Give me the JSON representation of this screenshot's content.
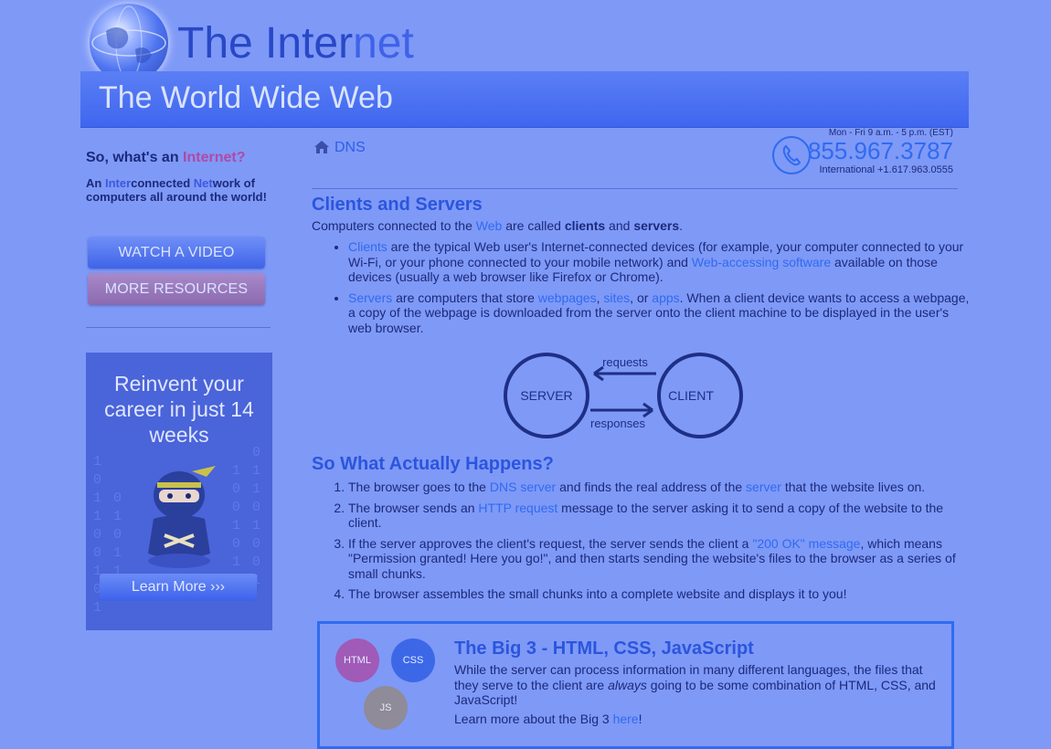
{
  "header": {
    "title_main": "The Inter",
    "title_net": "net",
    "banner": "The World Wide Web"
  },
  "sidebar": {
    "question_prefix": "So, what's an ",
    "question_highlight": "Internet?",
    "desc_parts": [
      "An ",
      "Inter",
      "connected ",
      "Net",
      "work of computers all around the world!"
    ],
    "watch_video": "WATCH A VIDEO",
    "more_resources": "MORE RESOURCES",
    "ad": {
      "title": "Reinvent your career in just 14 weeks",
      "button": "Learn More ›››"
    }
  },
  "breadcrumb": {
    "label": "DNS"
  },
  "contact": {
    "hours": "Mon - Fri 9 a.m. - 5 p.m. (EST)",
    "phone": "855.967.3787",
    "international": "International +1.617.963.0555"
  },
  "clients_servers": {
    "heading": "Clients and Servers",
    "intro": {
      "a": "Computers connected to the ",
      "link": "Web",
      "b": " are called ",
      "c": "clients",
      "d": " and ",
      "e": "servers",
      "f": "."
    },
    "bullet1": {
      "link1": "Clients",
      "a": " are the typical Web user's Internet-connected devices (for example, your computer connected to your Wi-Fi, or your phone connected to your mobile network) and ",
      "link2": "Web-accessing software",
      "b": " available on those devices (usually a web browser like Firefox or Chrome)."
    },
    "bullet2": {
      "link1": "Servers",
      "a": " are computers that store ",
      "link2": "webpages",
      "b": ", ",
      "link3": "sites",
      "c": ", or ",
      "link4": "apps",
      "d": ". When a client device wants to access a webpage, a copy of the webpage is downloaded from the server onto the client machine to be displayed in the user's web browser."
    },
    "diagram": {
      "server": "SERVER",
      "client": "CLIENT",
      "requests": "requests",
      "responses": "responses"
    }
  },
  "what_happens": {
    "heading": "So What Actually Happens?",
    "step1": {
      "a": "The browser goes to the ",
      "link1": "DNS server",
      "b": " and finds the real address of the ",
      "link2": "server",
      "c": " that the website lives on."
    },
    "step2": {
      "a": "The browser sends an ",
      "link": "HTTP request",
      "b": " message to the server asking it to send a copy of the website to the client."
    },
    "step3": {
      "a": "If the server approves the client's request, the server sends the client a ",
      "link": "\"200 OK\" message",
      "b": ", which means \"Permission granted! Here you go!\", and then starts sending the website's files to the browser as a series of small chunks."
    },
    "step4": {
      "a": "The browser assembles the small chunks into a complete website and displays it to you!"
    }
  },
  "big3": {
    "heading": "The Big 3 - HTML, CSS, JavaScript",
    "p1a": "While the server can process information in many different languages, the files that they serve to the client are ",
    "p1em": "always",
    "p1b": " going to be some combination of HTML, CSS, and JavaScript!",
    "p2a": "Learn more about the Big 3 ",
    "p2link": "here",
    "p2b": "!",
    "badge_html": "HTML",
    "badge_css": "CSS",
    "badge_js": "JS"
  },
  "colors": {
    "background": "#7f99f7",
    "link": "#2f6bf0",
    "heading": "#2b55dd",
    "banner": "#4a6ef2",
    "highlight": "#b04aa5"
  }
}
